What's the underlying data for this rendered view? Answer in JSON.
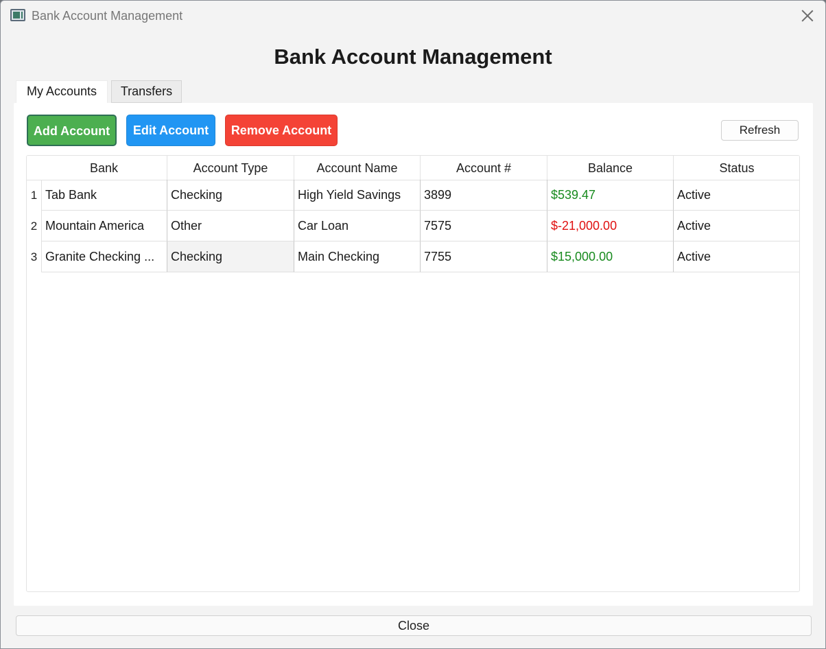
{
  "window": {
    "title": "Bank Account Management"
  },
  "header": {
    "title": "Bank Account Management"
  },
  "tabs": [
    {
      "label": "My Accounts",
      "active": true
    },
    {
      "label": "Transfers",
      "active": false
    }
  ],
  "toolbar": {
    "add_label": "Add Account",
    "edit_label": "Edit Account",
    "remove_label": "Remove Account",
    "refresh_label": "Refresh"
  },
  "colors": {
    "add": "#4caf50",
    "edit": "#2196f3",
    "remove": "#f44336",
    "positive": "#178a1d",
    "negative": "#e01010"
  },
  "table": {
    "columns": [
      "Bank",
      "Account Type",
      "Account Name",
      "Account #",
      "Balance",
      "Status"
    ],
    "rows": [
      {
        "num": "1",
        "bank": "Tab Bank",
        "type": "Checking",
        "name": "High Yield Savings",
        "number": "3899",
        "balance": "$539.47",
        "status": "Active"
      },
      {
        "num": "2",
        "bank": "Mountain America",
        "type": "Other",
        "name": "Car Loan",
        "number": "7575",
        "balance": "$-21,000.00",
        "status": "Active"
      },
      {
        "num": "3",
        "bank": "Granite Checking ...",
        "type": "Checking",
        "name": "Main Checking",
        "number": "7755",
        "balance": "$15,000.00",
        "status": "Active"
      }
    ]
  },
  "footer": {
    "close_label": "Close"
  }
}
